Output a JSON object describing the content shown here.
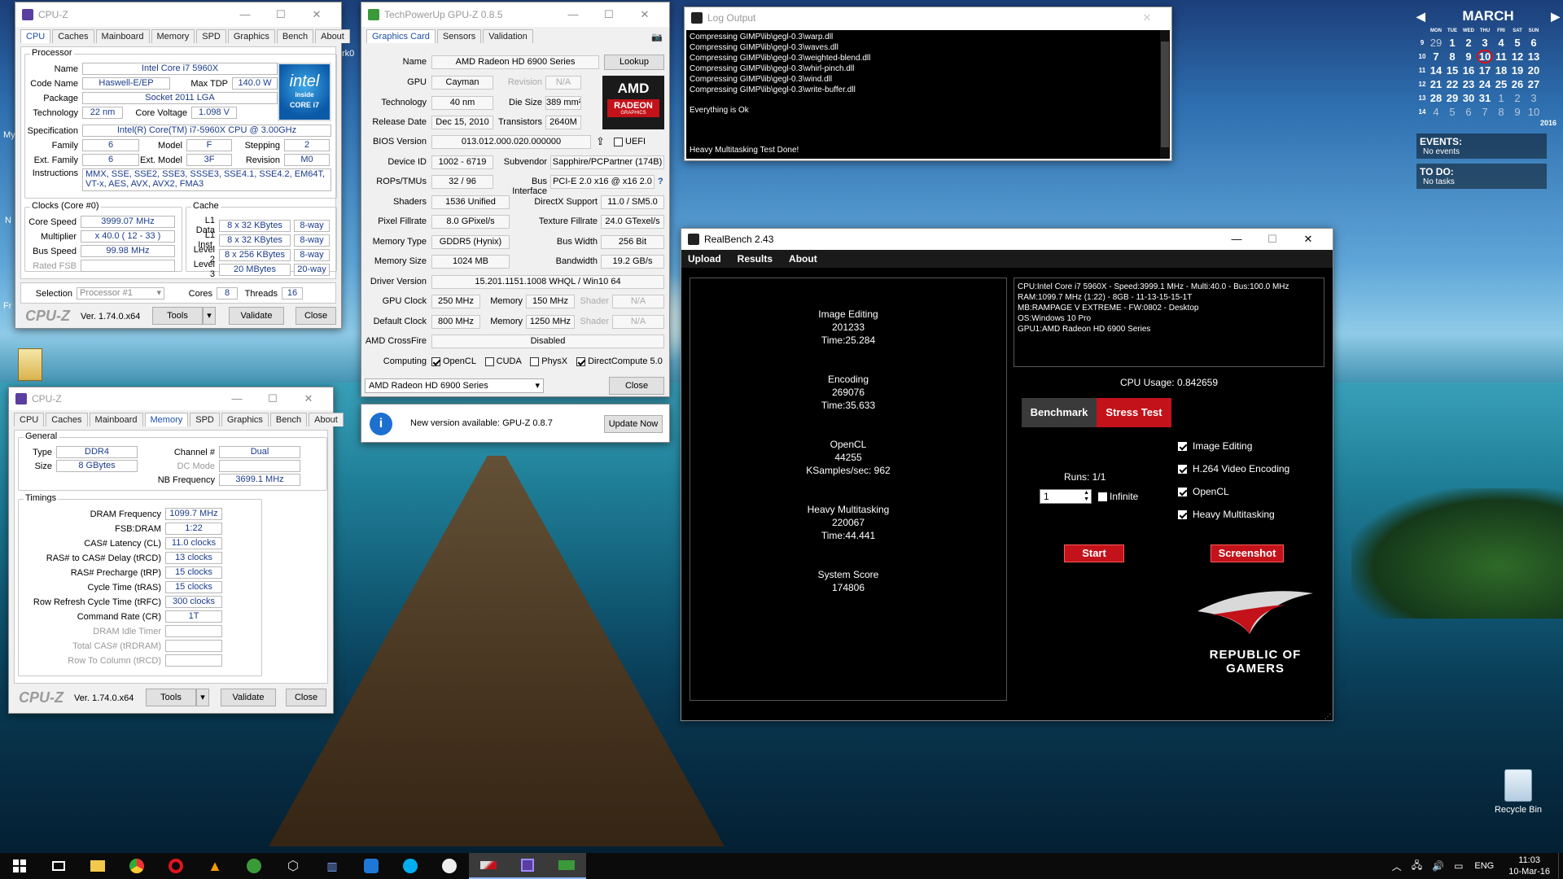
{
  "cpuz_cpu": {
    "title": "CPU-Z",
    "tabs": [
      "CPU",
      "Caches",
      "Mainboard",
      "Memory",
      "SPD",
      "Graphics",
      "Bench",
      "About"
    ],
    "active_tab": "CPU",
    "processor_legend": "Processor",
    "name_lbl": "Name",
    "name": "Intel Core i7 5960X",
    "codename_lbl": "Code Name",
    "codename": "Haswell-E/EP",
    "maxtdp_lbl": "Max TDP",
    "maxtdp": "140.0 W",
    "package_lbl": "Package",
    "package": "Socket 2011 LGA",
    "tech_lbl": "Technology",
    "tech": "22 nm",
    "corev_lbl": "Core Voltage",
    "corev": "1.098 V",
    "spec_lbl": "Specification",
    "spec": "Intel(R) Core(TM) i7-5960X CPU @ 3.00GHz",
    "family_lbl": "Family",
    "family": "6",
    "model_lbl": "Model",
    "model": "F",
    "stepping_lbl": "Stepping",
    "stepping": "2",
    "extfamily_lbl": "Ext. Family",
    "extfamily": "6",
    "extmodel_lbl": "Ext. Model",
    "extmodel": "3F",
    "revision_lbl": "Revision",
    "revision": "M0",
    "instr_lbl": "Instructions",
    "instr": "MMX, SSE, SSE2, SSE3, SSSE3, SSE4.1, SSE4.2, EM64T, VT-x, AES, AVX, AVX2, FMA3",
    "clocks_legend": "Clocks (Core #0)",
    "corespeed_lbl": "Core Speed",
    "corespeed": "3999.07 MHz",
    "mult_lbl": "Multiplier",
    "mult": "x 40.0 ( 12 - 33 )",
    "bus_lbl": "Bus Speed",
    "bus": "99.98 MHz",
    "fsb_lbl": "Rated FSB",
    "cache_legend": "Cache",
    "l1d_lbl": "L1 Data",
    "l1d": "8 x 32 KBytes",
    "l1d_w": "8-way",
    "l1i_lbl": "L1 Inst.",
    "l1i": "8 x 32 KBytes",
    "l1i_w": "8-way",
    "l2_lbl": "Level 2",
    "l2": "8 x 256 KBytes",
    "l2_w": "8-way",
    "l3_lbl": "Level 3",
    "l3": "20 MBytes",
    "l3_w": "20-way",
    "selection_lbl": "Selection",
    "selection": "Processor #1",
    "cores_lbl": "Cores",
    "cores": "8",
    "threads_lbl": "Threads",
    "threads": "16",
    "logo": "CPU-Z",
    "version": "Ver. 1.74.0.x64",
    "tools": "Tools",
    "validate": "Validate",
    "close": "Close",
    "intel_line1": "intel",
    "intel_line2": "inside",
    "intel_line3": "CORE i7"
  },
  "cpuz_mem": {
    "title": "CPU-Z",
    "tabs": [
      "CPU",
      "Caches",
      "Mainboard",
      "Memory",
      "SPD",
      "Graphics",
      "Bench",
      "About"
    ],
    "active_tab": "Memory",
    "general_legend": "General",
    "type_lbl": "Type",
    "type": "DDR4",
    "size_lbl": "Size",
    "size": "8 GBytes",
    "channel_lbl": "Channel #",
    "channel": "Dual",
    "dcmode_lbl": "DC Mode",
    "nbfreq_lbl": "NB Frequency",
    "nbfreq": "3699.1 MHz",
    "timings_legend": "Timings",
    "timings": [
      {
        "label": "DRAM Frequency",
        "value": "1099.7 MHz",
        "dim": false
      },
      {
        "label": "FSB:DRAM",
        "value": "1:22",
        "dim": false
      },
      {
        "label": "CAS# Latency (CL)",
        "value": "11.0 clocks",
        "dim": false
      },
      {
        "label": "RAS# to CAS# Delay (tRCD)",
        "value": "13 clocks",
        "dim": false
      },
      {
        "label": "RAS# Precharge (tRP)",
        "value": "15 clocks",
        "dim": false
      },
      {
        "label": "Cycle Time (tRAS)",
        "value": "15 clocks",
        "dim": false
      },
      {
        "label": "Row Refresh Cycle Time (tRFC)",
        "value": "300 clocks",
        "dim": false
      },
      {
        "label": "Command Rate (CR)",
        "value": "1T",
        "dim": false
      },
      {
        "label": "DRAM Idle Timer",
        "value": "",
        "dim": true
      },
      {
        "label": "Total CAS# (tRDRAM)",
        "value": "",
        "dim": true
      },
      {
        "label": "Row To Column (tRCD)",
        "value": "",
        "dim": true
      }
    ],
    "logo": "CPU-Z",
    "version": "Ver. 1.74.0.x64",
    "tools": "Tools",
    "validate": "Validate",
    "close": "Close"
  },
  "gpuz": {
    "title": "TechPowerUp GPU-Z 0.8.5",
    "tabs": [
      "Graphics Card",
      "Sensors",
      "Validation"
    ],
    "active_tab": "Graphics Card",
    "name_lbl": "Name",
    "name": "AMD Radeon HD 6900 Series",
    "lookup": "Lookup",
    "gpu_lbl": "GPU",
    "gpu": "Cayman",
    "revision_lbl": "Revision",
    "revision": "N/A",
    "tech_lbl": "Technology",
    "tech": "40 nm",
    "diesize_lbl": "Die Size",
    "diesize": "389 mm²",
    "release_lbl": "Release Date",
    "release": "Dec 15, 2010",
    "trans_lbl": "Transistors",
    "trans": "2640M",
    "bios_lbl": "BIOS Version",
    "bios": "013.012.000.020.000000",
    "uefi": "UEFI",
    "devid_lbl": "Device ID",
    "devid": "1002 - 6719",
    "subv_lbl": "Subvendor",
    "subv": "Sapphire/PCPartner (174B)",
    "rops_lbl": "ROPs/TMUs",
    "rops": "32 / 96",
    "busif_lbl": "Bus Interface",
    "busif": "PCI-E 2.0 x16 @ x16 2.0",
    "shaders_lbl": "Shaders",
    "shaders": "1536 Unified",
    "dx_lbl": "DirectX Support",
    "dx": "11.0 / SM5.0",
    "pixfill_lbl": "Pixel Fillrate",
    "pixfill": "8.0 GPixel/s",
    "texfill_lbl": "Texture Fillrate",
    "texfill": "24.0 GTexel/s",
    "memtype_lbl": "Memory Type",
    "memtype": "GDDR5 (Hynix)",
    "buswidth_lbl": "Bus Width",
    "buswidth": "256 Bit",
    "memsize_lbl": "Memory Size",
    "memsize": "1024 MB",
    "bandwidth_lbl": "Bandwidth",
    "bandwidth": "19.2 GB/s",
    "driver_lbl": "Driver Version",
    "driver": "15.201.1151.1008 WHQL / Win10 64",
    "gpuclock_lbl": "GPU Clock",
    "gpuclock": "250 MHz",
    "mem1_lbl": "Memory",
    "mem1": "150 MHz",
    "shader1_lbl": "Shader",
    "shader1": "N/A",
    "defclock_lbl": "Default Clock",
    "defclock": "800 MHz",
    "mem2_lbl": "Memory",
    "mem2": "1250 MHz",
    "shader2_lbl": "Shader",
    "shader2": "N/A",
    "crossfire_lbl": "AMD CrossFire",
    "crossfire": "Disabled",
    "computing_lbl": "Computing",
    "opencl": "OpenCL",
    "cuda": "CUDA",
    "physx": "PhysX",
    "dc": "DirectCompute 5.0",
    "select": "AMD Radeon HD 6900 Series",
    "close": "Close",
    "update_msg": "New version available: GPU-Z 0.8.7",
    "update_btn": "Update Now",
    "amd_logo": "AMD",
    "radeon": "RADEON",
    "graphics": "GRAPHICS"
  },
  "log": {
    "title": "Log Output",
    "lines": [
      "Compressing  GIMP\\lib\\gegl-0.3\\warp.dll",
      "Compressing  GIMP\\lib\\gegl-0.3\\waves.dll",
      "Compressing  GIMP\\lib\\gegl-0.3\\weighted-blend.dll",
      "Compressing  GIMP\\lib\\gegl-0.3\\whirl-pinch.dll",
      "Compressing  GIMP\\lib\\gegl-0.3\\wind.dll",
      "Compressing  GIMP\\lib\\gegl-0.3\\write-buffer.dll"
    ],
    "ok": "Everything is Ok",
    "done": "Heavy Multitasking Test Done!"
  },
  "realbench": {
    "title": "RealBench 2.43",
    "menu": [
      "Upload",
      "Results",
      "About"
    ],
    "results": [
      {
        "name": "Image Editing",
        "score": "201233",
        "extra": "Time:25.284"
      },
      {
        "name": "Encoding",
        "score": "269076",
        "extra": "Time:35.633"
      },
      {
        "name": "OpenCL",
        "score": "44255",
        "extra": "KSamples/sec: 962"
      },
      {
        "name": "Heavy Multitasking",
        "score": "220067",
        "extra": "Time:44.441"
      },
      {
        "name": "System Score",
        "score": "174806",
        "extra": ""
      }
    ],
    "sysinfo": [
      "CPU:Intel Core i7 5960X - Speed:3999.1 MHz - Multi:40.0 - Bus:100.0 MHz",
      "RAM:1099.7 MHz (1:22) - 8GB - 11-13-15-15-1T",
      "MB:RAMPAGE V EXTREME - FW:0802 - Desktop",
      "OS:Windows 10 Pro",
      "GPU1:AMD Radeon HD 6900 Series"
    ],
    "cpu_usage": "CPU Usage: 0.842659",
    "benchmark": "Benchmark",
    "stress": "Stress Test",
    "runs_lbl": "Runs: 1/1",
    "runs": "1",
    "infinite": "Infinite",
    "checks": [
      "Image Editing",
      "H.264 Video Encoding",
      "OpenCL",
      "Heavy Multitasking"
    ],
    "start": "Start",
    "screenshot": "Screenshot",
    "rog1": "REPUBLIC OF",
    "rog2": "GAMERS"
  },
  "calendar": {
    "month": "MARCH",
    "days_hdr": [
      "MON",
      "TUE",
      "WED",
      "THU",
      "FRI",
      "SAT",
      "SUN"
    ],
    "weeks": [
      {
        "wk": "9",
        "days": [
          "29",
          "1",
          "2",
          "3",
          "4",
          "5",
          "6"
        ]
      },
      {
        "wk": "10",
        "days": [
          "7",
          "8",
          "9",
          "10",
          "11",
          "12",
          "13"
        ]
      },
      {
        "wk": "11",
        "days": [
          "14",
          "15",
          "16",
          "17",
          "18",
          "19",
          "20"
        ]
      },
      {
        "wk": "12",
        "days": [
          "21",
          "22",
          "23",
          "24",
          "25",
          "26",
          "27"
        ]
      },
      {
        "wk": "13",
        "days": [
          "28",
          "29",
          "30",
          "31",
          "1",
          "2",
          "3"
        ]
      },
      {
        "wk": "14",
        "days": [
          "4",
          "5",
          "6",
          "7",
          "8",
          "9",
          "10"
        ]
      }
    ],
    "year": "2016",
    "events_title": "EVENTS:",
    "events": "No events",
    "todo_title": "TO DO:",
    "todo": "No tasks"
  },
  "desktop": {
    "recycle": "Recycle Bin",
    "my": "My",
    "fr": "Fr",
    "n": "N",
    "rk": "rk0"
  },
  "taskbar": {
    "lang": "ENG",
    "time": "11:03",
    "date": "10-Mar-16"
  }
}
